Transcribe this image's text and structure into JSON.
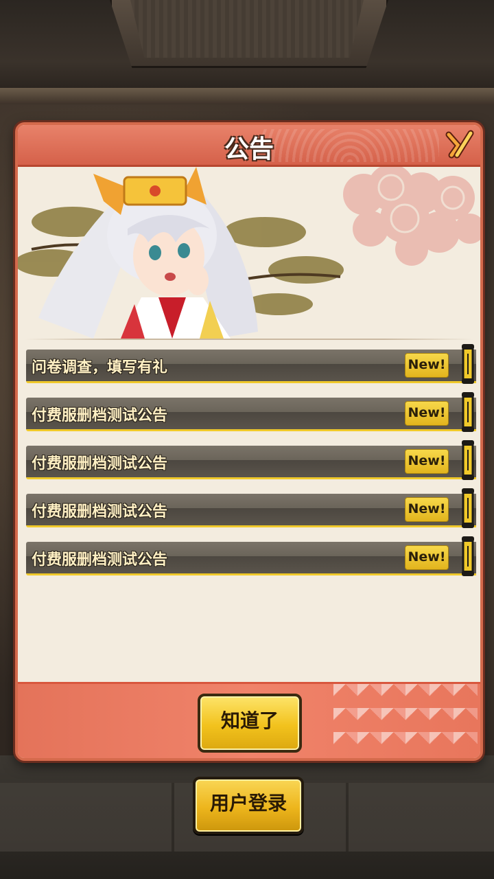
{
  "dialog": {
    "title": "公告",
    "close_icon": "close-x-icon",
    "ok_label": "知道了"
  },
  "notices": [
    {
      "title": "问卷调查，填写有礼",
      "badge": "New!"
    },
    {
      "title": "付费服删档测试公告",
      "badge": "New!"
    },
    {
      "title": "付费服删档测试公告",
      "badge": "New!"
    },
    {
      "title": "付费服删档测试公告",
      "badge": "New!"
    },
    {
      "title": "付费服删档测试公告",
      "badge": "New!"
    }
  ],
  "login": {
    "label": "用户登录"
  },
  "colors": {
    "header": "#d5614a",
    "panel": "#f3ecdf",
    "notice_bar": "#6b655a",
    "accent_yellow": "#f0c92a",
    "button_yellow": "#f2c21d"
  }
}
